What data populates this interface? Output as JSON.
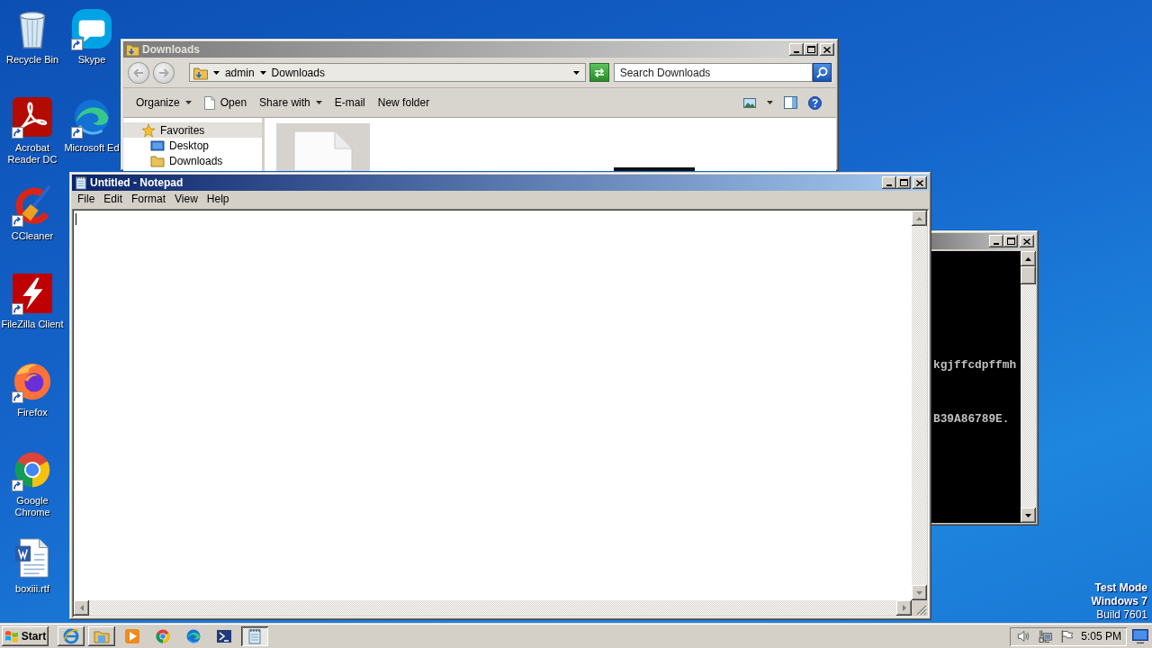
{
  "desktop": {
    "icons": [
      {
        "label": "Recycle Bin",
        "kind": "bin",
        "shortcut": false
      },
      {
        "label": "Acrobat Reader DC",
        "kind": "reader",
        "shortcut": true
      },
      {
        "label": "CCleaner",
        "kind": "cleaner",
        "shortcut": true
      },
      {
        "label": "FileZilla Client",
        "kind": "ftp",
        "shortcut": true
      },
      {
        "label": "Firefox",
        "kind": "firefox",
        "shortcut": true
      },
      {
        "label": "Google Chrome",
        "kind": "chrome",
        "shortcut": true
      },
      {
        "label": "boxiii.rtf",
        "kind": "document",
        "shortcut": false
      },
      {
        "label": "Skype",
        "kind": "chat",
        "shortcut": true
      },
      {
        "label": "Microsoft Ed",
        "kind": "edge",
        "shortcut": true
      }
    ],
    "notice": {
      "lines": [
        "Test Mode",
        "Windows 7"
      ],
      "build": "Build 7601"
    }
  },
  "explorer": {
    "title": "Downloads",
    "active": false,
    "path": [
      "admin",
      "Downloads"
    ],
    "search": {
      "placeholder": "Search Downloads"
    },
    "toolbar": [
      {
        "label": "Organize",
        "kind": "menu"
      },
      {
        "label": "Open",
        "kind": "file"
      },
      {
        "label": "Share with",
        "kind": "menu"
      },
      {
        "label": "E-mail",
        "kind": "plain"
      },
      {
        "label": "New folder",
        "kind": "plain"
      }
    ],
    "nav": [
      {
        "label": "Favorites",
        "kind": "star",
        "selected": true
      },
      {
        "label": "Desktop",
        "kind": "desktop",
        "selected": false
      },
      {
        "label": "Downloads",
        "kind": "folder",
        "selected": false
      }
    ]
  },
  "notepad": {
    "title": "Untitled - Notepad",
    "active": true,
    "menu": [
      "File",
      "Edit",
      "Format",
      "View",
      "Help"
    ]
  },
  "console": {
    "active": false,
    "lines": [
      "kgjffcdpffmh",
      "B39A86789E."
    ]
  },
  "taskbar": {
    "start": "Start",
    "buttons": [
      {
        "kind": "ie",
        "raised": true,
        "selected": false
      },
      {
        "kind": "explorer",
        "raised": true,
        "selected": false
      },
      {
        "kind": "media",
        "raised": false,
        "selected": false
      },
      {
        "kind": "chrome",
        "raised": false,
        "selected": false
      },
      {
        "kind": "edge",
        "raised": false,
        "selected": false
      },
      {
        "kind": "shell",
        "raised": false,
        "selected": false
      },
      {
        "kind": "notepad",
        "raised": true,
        "selected": true
      }
    ],
    "clock": "5:05 PM"
  }
}
